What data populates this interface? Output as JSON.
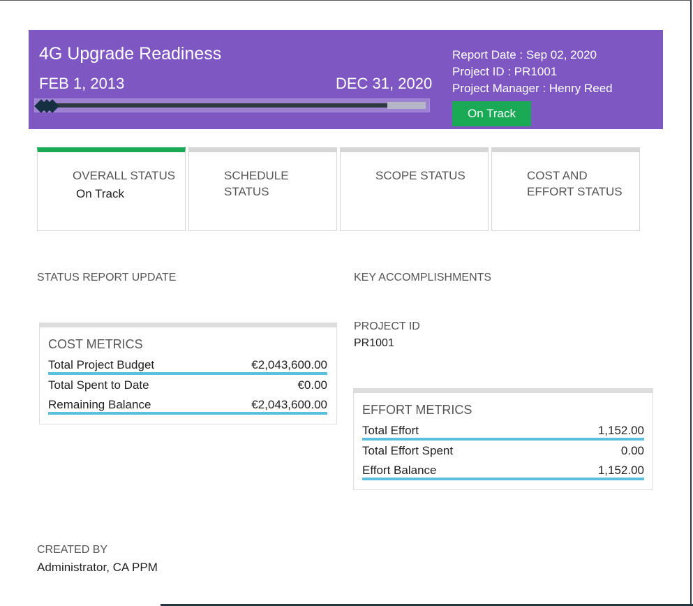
{
  "header": {
    "title": "4G Upgrade Readiness",
    "start_date": "FEB 1, 2013",
    "end_date": "DEC 31, 2020",
    "report_date": "Report Date : Sep 02, 2020",
    "project_id": "Project ID : PR1001",
    "project_manager": "Project Manager : Henry Reed",
    "status_badge": "On Track",
    "timeline_progress": 0.9
  },
  "cards": [
    {
      "label": "OVERALL STATUS",
      "value": "On Track",
      "color": "#1aaa55"
    },
    {
      "label": "SCHEDULE STATUS"
    },
    {
      "label": "SCOPE STATUS"
    },
    {
      "label": "COST AND EFFORT STATUS"
    }
  ],
  "sections": {
    "status_report": "STATUS REPORT UPDATE",
    "key_accomplishments": "KEY ACCOMPLISHMENTS",
    "project_id_label": "PROJECT ID",
    "project_id_value": "PR1001",
    "created_by_label": "CREATED BY",
    "created_by_value": "Administrator, CA PPM"
  },
  "cost": {
    "title": "COST METRICS",
    "rows": [
      {
        "label": "Total Project Budget",
        "value": "€2,043,600.00"
      },
      {
        "label": "Total Spent to Date",
        "value": "€0.00"
      },
      {
        "label": "Remaining Balance",
        "value": "€2,043,600.00"
      }
    ]
  },
  "effort": {
    "title": "EFFORT METRICS",
    "rows": [
      {
        "label": "Total Effort",
        "value": "1,152.00"
      },
      {
        "label": "Total Effort Spent",
        "value": "0.00"
      },
      {
        "label": "Effort Balance",
        "value": "1,152.00"
      }
    ]
  }
}
